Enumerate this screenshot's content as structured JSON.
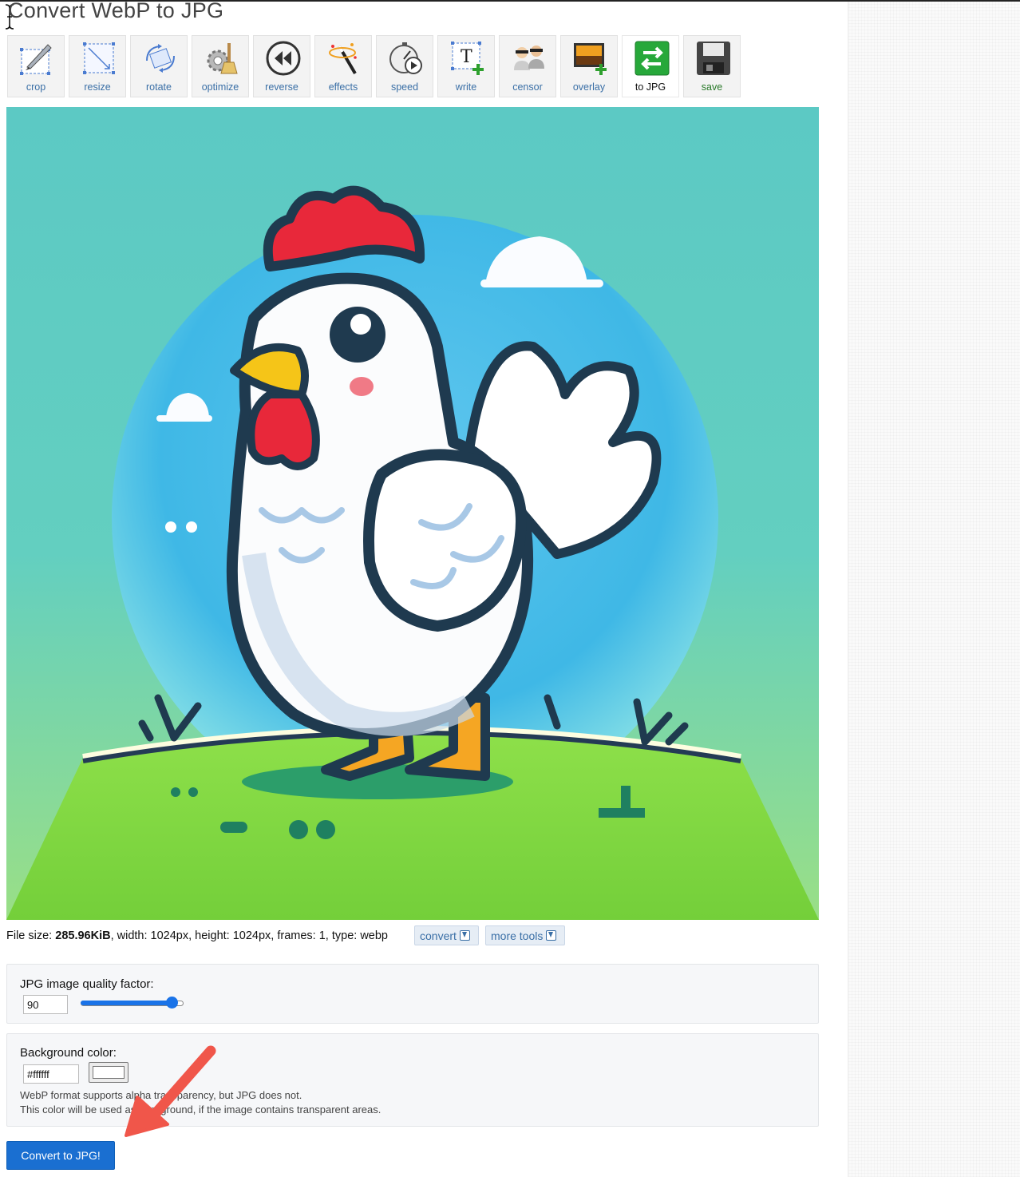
{
  "page": {
    "title": "Convert WebP to JPG"
  },
  "toolbar": {
    "tools": [
      {
        "label": "crop",
        "icon": "crop-icon"
      },
      {
        "label": "resize",
        "icon": "resize-icon"
      },
      {
        "label": "rotate",
        "icon": "rotate-icon"
      },
      {
        "label": "optimize",
        "icon": "optimize-icon"
      },
      {
        "label": "reverse",
        "icon": "reverse-icon"
      },
      {
        "label": "effects",
        "icon": "effects-icon"
      },
      {
        "label": "speed",
        "icon": "speed-icon"
      },
      {
        "label": "write",
        "icon": "write-icon"
      },
      {
        "label": "censor",
        "icon": "censor-icon"
      },
      {
        "label": "overlay",
        "icon": "overlay-icon"
      },
      {
        "label": "to JPG",
        "icon": "convert-to-jpg-icon",
        "active": true
      },
      {
        "label": "save",
        "icon": "save-icon"
      }
    ]
  },
  "preview": {
    "subject": "cartoon chicken illustration"
  },
  "fileinfo": {
    "size_prefix": "File size: ",
    "size_value": "285.96KiB",
    "rest": ", width: 1024px, height: 1024px, frames: 1, type: webp",
    "convert_label": "convert",
    "more_tools_label": "more tools"
  },
  "quality": {
    "label": "JPG image quality factor:",
    "value": "90",
    "slider_fraction": 0.9
  },
  "background": {
    "label": "Background color:",
    "value": "#ffffff",
    "swatch_color": "#ffffff",
    "note_line1": "WebP format supports alpha transparency, but JPG does not.",
    "note_line2": "This color will be used as background, if the image contains transparent areas."
  },
  "submit": {
    "label": "Convert to JPG!"
  },
  "colors": {
    "accent": "#1a6fd1",
    "link": "#3a6fa6",
    "annotation_arrow": "#f0564a"
  }
}
